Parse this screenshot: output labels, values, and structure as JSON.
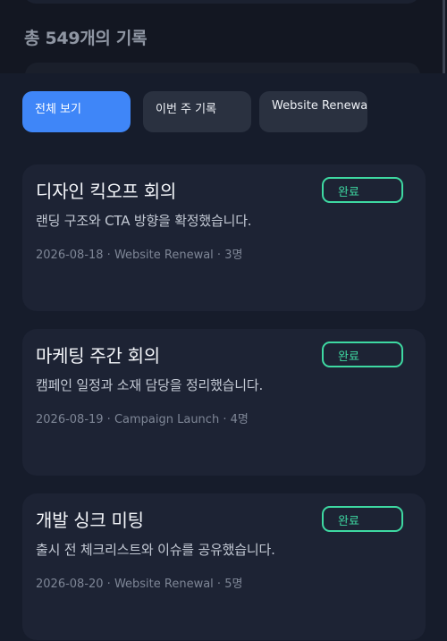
{
  "header": {
    "record_count": "총 549개의 기록"
  },
  "filters": [
    {
      "label": "전체 보기",
      "active": true
    },
    {
      "label": "이번 주 기록",
      "active": false
    },
    {
      "label": "Website Renewal",
      "active": false
    }
  ],
  "meetings": [
    {
      "title": "디자인 킥오프 회의",
      "status": "완료",
      "summary": "랜딩 구조와 CTA 방향을 확정했습니다.",
      "meta": "2026-08-18 · Website Renewal · 3명"
    },
    {
      "title": "마케팅 주간 회의",
      "status": "완료",
      "summary": "캠페인 일정과 소재 담당을 정리했습니다.",
      "meta": "2026-08-19 · Campaign Launch · 4명"
    },
    {
      "title": "개발 싱크 미팅",
      "status": "완료",
      "summary": "출시 전 체크리스트와 이슈를 공유했습니다.",
      "meta": "2026-08-20 · Website Renewal · 5명"
    }
  ],
  "colors": {
    "accent": "#3f86f8",
    "status_done": "#3ed9a2",
    "card_bg": "#1d2334"
  }
}
